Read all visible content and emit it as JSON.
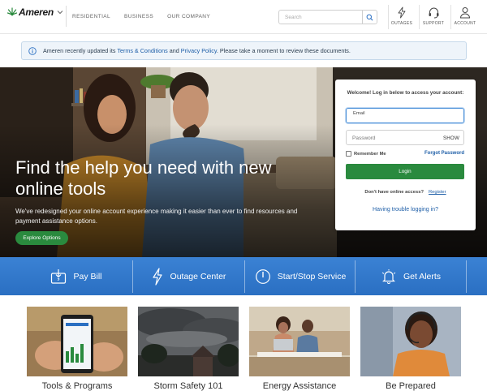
{
  "header": {
    "logo_text": "Ameren",
    "nav": [
      "RESIDENTIAL",
      "BUSINESS",
      "OUR COMPANY"
    ],
    "search_placeholder": "Search",
    "utilities": [
      "OUTAGES",
      "SUPPORT",
      "ACCOUNT"
    ]
  },
  "notice": {
    "prefix": "Ameren recently updated its ",
    "terms_link": "Terms & Conditions",
    "and": " and ",
    "privacy_link": "Privacy Policy",
    "suffix": ". Please take a moment to review these documents."
  },
  "hero": {
    "title": "Find the help you need with new online tools",
    "text": "We've redesigned your online account experience making it easier than ever to find resources and payment assistance options.",
    "button": "Explore Options"
  },
  "login": {
    "welcome": "Welcome! Log in below to access your account:",
    "email_label": "Email",
    "password_placeholder": "Password",
    "show_label": "SHOW",
    "remember_label": "Remember Me",
    "forgot_link": "Forgot Password",
    "login_button": "Login",
    "no_account_text": "Don't have online access?",
    "register_link": "Register",
    "trouble_link": "Having trouble logging in?"
  },
  "services": [
    "Pay Bill",
    "Outage Center",
    "Start/Stop Service",
    "Get Alerts"
  ],
  "cards": [
    "Tools & Programs",
    "Storm Safety 101",
    "Energy Assistance",
    "Be Prepared"
  ],
  "colors": {
    "accent_blue": "#2a6fc2",
    "accent_green": "#2a8a3e",
    "link_blue": "#1f5fa8"
  }
}
